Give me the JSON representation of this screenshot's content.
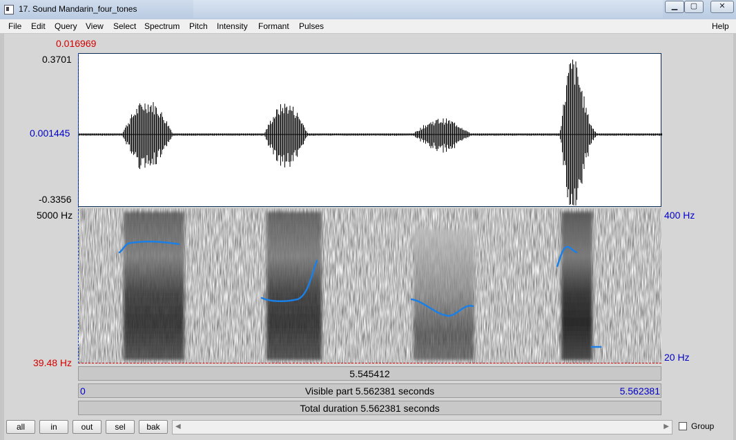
{
  "window": {
    "title": "17. Sound Mandarin_four_tones",
    "minimize": "▁",
    "maximize": "▢",
    "close": "✕"
  },
  "menu": [
    "File",
    "Edit",
    "Query",
    "View",
    "Select",
    "Spectrum",
    "Pitch",
    "Intensity",
    "Formant",
    "Pulses"
  ],
  "help": "Help",
  "waveform": {
    "cursor_value": "0.016969",
    "y_max": "0.3701",
    "y_mid": "0.001445",
    "y_min": "-0.3356"
  },
  "spectrogram": {
    "freq_max": "5000 Hz",
    "freq_min": "39.48 Hz",
    "pitch_max": "400 Hz",
    "pitch_min": "20 Hz"
  },
  "time": {
    "cursor_time": "5.545412",
    "visible_start": "0",
    "visible_label": "Visible part 5.562381 seconds",
    "visible_end": "5.562381",
    "total_label": "Total duration 5.562381 seconds"
  },
  "toolbar": {
    "all": "all",
    "in": "in",
    "out": "out",
    "sel": "sel",
    "bak": "bak",
    "group_label": "Group",
    "group_checked": false
  },
  "colors": {
    "cursor_red": "#d40000",
    "axis_blue": "#0000c8",
    "pitch_blue": "#1a7fe6"
  }
}
